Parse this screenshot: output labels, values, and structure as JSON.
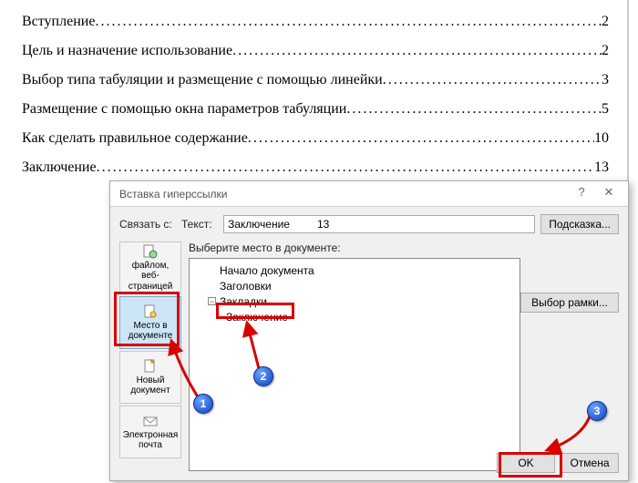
{
  "toc": [
    {
      "title": "Вступление",
      "page": "2"
    },
    {
      "title": "Цель и назначение использование",
      "page": "2"
    },
    {
      "title": "Выбор типа табуляции и размещение с помощью линейки",
      "page": "3"
    },
    {
      "title": "Размещение с помощью окна параметров табуляции",
      "page": "5"
    },
    {
      "title": "Как сделать правильное содержание",
      "page": "10"
    },
    {
      "title": "Заключение",
      "page": "13"
    }
  ],
  "dialog": {
    "title": "Вставка гиперссылки",
    "help_glyph": "?",
    "close_glyph": "✕",
    "link_to_label": "Связать с:",
    "text_label": "Текст:",
    "text_value": "Заключение         13",
    "tooltip_button": "Подсказка...",
    "select_prompt": "Выберите место в документе:",
    "frame_button": "Выбор рамки...",
    "ok": "OK",
    "cancel": "Отмена",
    "sidebar": [
      {
        "label": "файлом, веб-страницей"
      },
      {
        "label": "Место в документе"
      },
      {
        "label": "Новый документ"
      },
      {
        "label": "Электронная почта"
      }
    ],
    "tree": {
      "root1": "Начало документа",
      "root2": "Заголовки",
      "root3": "Закладки",
      "child": "Заключение"
    }
  },
  "callouts": {
    "n1": "1",
    "n2": "2",
    "n3": "3"
  }
}
